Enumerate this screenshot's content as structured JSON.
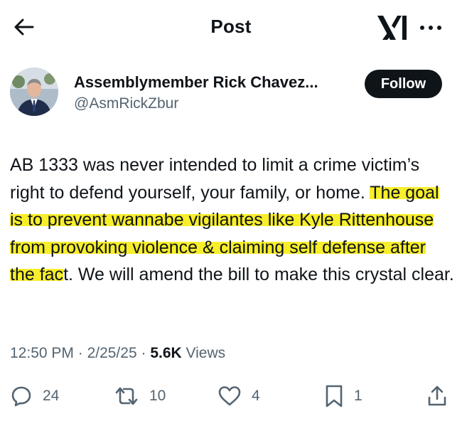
{
  "header": {
    "title": "Post",
    "back_icon": "arrow-left-icon",
    "logo_icon": "xai-logo",
    "more_icon": "more-horizontal-icon"
  },
  "author": {
    "name": "Assemblymember Rick Chavez...",
    "handle": "@AsmRickZbur",
    "follow_label": "Follow"
  },
  "post": {
    "text_before": "AB 1333 was never intended to limit a crime victim’s right to defend yourself, your family, or home. ",
    "text_highlighted": "The goal is to prevent wannabe vigilantes like Kyle Rittenhouse from provoking violence & claiming self defense after the fac",
    "text_after": "t. We will amend the bill to make this crystal clear.",
    "highlight_color": "#f7ee2c"
  },
  "meta": {
    "time": "12:50 PM",
    "separator": " · ",
    "date": "2/25/25",
    "views_count": "5.6K",
    "views_label": " Views"
  },
  "actions": {
    "replies": "24",
    "reposts": "10",
    "likes": "4",
    "bookmarks": "1"
  },
  "colors": {
    "text": "#0f1419",
    "secondary": "#536471",
    "follow_bg": "#0f1419",
    "follow_text": "#ffffff"
  }
}
